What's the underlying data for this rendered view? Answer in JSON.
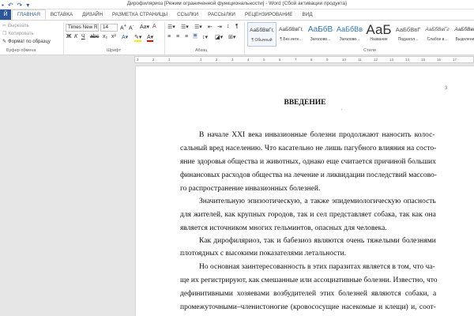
{
  "quick_access": {
    "save_icon": "save-icon",
    "undo_icon": "undo-icon",
    "redo_icon": "redo-icon"
  },
  "window": {
    "title": "Дирофиляриоз [Режим ограниченной функциональности] - Word (Сбой активации продукта)"
  },
  "ribbon_tabs": {
    "file": "Й",
    "items": [
      "ГЛАВНАЯ",
      "ВСТАВКА",
      "ДИЗАЙН",
      "РАЗМЕТКА СТРАНИЦЫ",
      "ССЫЛКИ",
      "РАССЫЛКИ",
      "РЕЦЕНЗИРОВАНИЕ",
      "ВИД"
    ],
    "active_index": 0
  },
  "clipboard": {
    "cut": "Вырезать",
    "copy": "Копировать",
    "format_painter": "Формат по образцу",
    "group_label": "Буфер обмена"
  },
  "font": {
    "name": "Times New R",
    "size": "14",
    "group_label": "Шрифт"
  },
  "paragraph": {
    "group_label": "Абзац"
  },
  "styles": {
    "group_label": "Стили",
    "items": [
      {
        "sample": "АаБбВвГг,",
        "name": "¶ Обычный",
        "selected": true
      },
      {
        "sample": "АаБбВвГг,",
        "name": "¶ Без инте...",
        "selected": false
      },
      {
        "sample": "АаБбВ",
        "name": "Заголово...",
        "selected": false
      },
      {
        "sample": "АаБбВв",
        "name": "Заголово...",
        "selected": false
      },
      {
        "sample": "АаБ",
        "name": "Название",
        "selected": false
      },
      {
        "sample": "АаБбВвГ",
        "name": "Подзагол...",
        "selected": false
      },
      {
        "sample": "АаБбВвГг",
        "name": "Слабое в...",
        "selected": false
      },
      {
        "sample": "АаБбВвГг",
        "name": "Выделени...",
        "selected": false
      }
    ]
  },
  "ruler": {
    "marks": [
      "3",
      "2",
      "1",
      "",
      "1",
      "2",
      "3",
      "4",
      "5",
      "6",
      "7",
      "8",
      "9",
      "10",
      "11",
      "12",
      "13",
      "14",
      "15",
      "16",
      "17"
    ]
  },
  "document": {
    "page_number": "3",
    "heading": "ВВЕДЕНИЕ",
    "lines": [
      "В начале XXI века инвазионные болезни продолжают наносить колос-",
      "сальный вред населению. Что касательно не лишь пагубного влияния на состо-",
      "яние здоровья общества и животных, однако еще считается причиной больших",
      "финансовых расходов общества на лечение и ликвидации последствий массово-",
      "го распространение инвазионных болезней.",
      "Значительную эпизоотическую, а также эпидемиологическую опасность",
      "для жителей, как крупных городов, так и сел представляет собака, так как она",
      "является источником многих гельминтов, опасных для человека.",
      "Как дирофиляриоз, так и бабезиоз являются очень тяжелыми болезнями",
      "плотоядных с высокими показателями летальности.",
      "Но основная заинтересованность в этих паразитах является в том, что ча-",
      "ще их регистрируют, как смешанные или ассоциативные болезни. Известно, что",
      "дефинитивными хозяевами возбудителей этих болезней являются собаки, а",
      "промежуточными–членистоногие (кровососущие насекомые и клещи) и, соот-"
    ]
  }
}
